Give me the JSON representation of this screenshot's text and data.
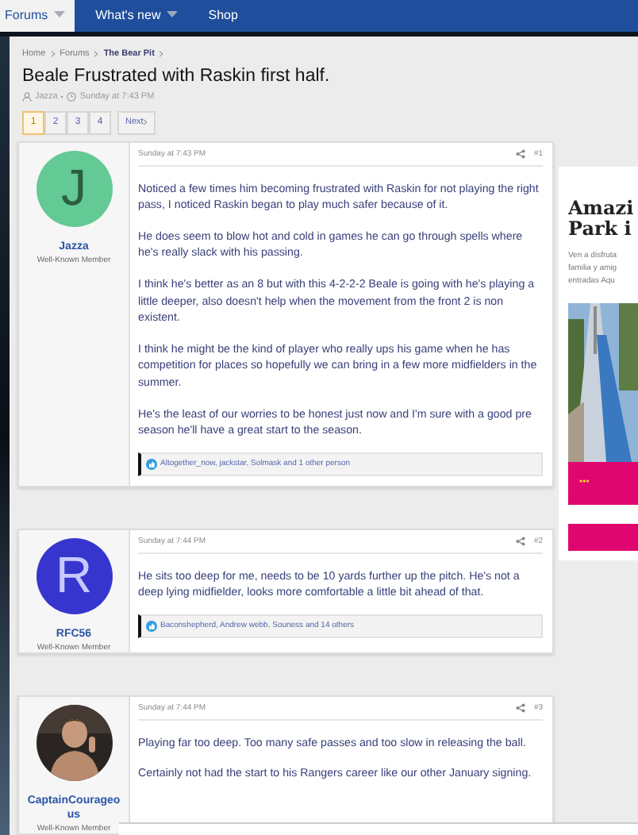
{
  "nav": [
    {
      "label": "Forums",
      "selected": true,
      "dropdown": true
    },
    {
      "label": "What's new",
      "selected": false,
      "dropdown": true
    },
    {
      "label": "Shop",
      "selected": false,
      "dropdown": false
    }
  ],
  "breadcrumb": [
    {
      "label": "Home",
      "bold": false
    },
    {
      "label": "Forums",
      "bold": false
    },
    {
      "label": "The Bear Pit",
      "bold": true
    }
  ],
  "thread": {
    "title": "Beale Frustrated with Raskin first half.",
    "author": "Jazza",
    "date": "Sunday at 7:43 PM"
  },
  "pagination": {
    "pages": [
      {
        "label": "1",
        "selected": true
      },
      {
        "label": "2",
        "selected": false
      },
      {
        "label": "3",
        "selected": false
      },
      {
        "label": "4",
        "selected": false
      }
    ],
    "next": "Next"
  },
  "posts": [
    {
      "avatar": {
        "kind": "letter",
        "letter": "J",
        "color": "#63c995"
      },
      "username": "Jazza",
      "role": "Well-Known Member",
      "date": "Sunday at 7:43 PM",
      "number": "#1",
      "paragraphs": [
        "Noticed a few times him becoming frustrated with Raskin for not playing the right pass, I noticed Raskin began to play much safer because of it.",
        "He does seem to blow hot and cold in games he can go through spells where he's really slack with his passing.",
        "I think he's better as an 8 but with this 4-2-2-2 Beale is going with he's playing a little deeper, also doesn't help when the movement from the front 2 is non existent.",
        "I think he might be the kind of player who really ups his game when he has competition for places so hopefully we can bring in a few more midfielders in the summer.",
        "He's the least of our worries to be honest just now and I'm sure with a good pre season he'll have a great start to the season."
      ],
      "reactions": "Altogether_now, jackstar, Solmask and 1 other person"
    },
    {
      "avatar": {
        "kind": "letter",
        "letter": "R",
        "color": "#3636cf"
      },
      "username": "RFC56",
      "role": "Well-Known Member",
      "date": "Sunday at 7:44 PM",
      "number": "#2",
      "paragraphs": [
        "He sits too deep for me, needs to be 10 yards further up the pitch. He's not a deep lying midfielder, looks more comfortable a little bit ahead of that."
      ],
      "reactions": "Baconshepherd, Andrew webb, Souness and 14 others"
    },
    {
      "avatar": {
        "kind": "picture"
      },
      "username": "CaptainCourageous",
      "role": "Well-Known Member",
      "date": "Sunday at 7:44 PM",
      "number": "#3",
      "paragraphs": [
        "Playing far too deep. Too many safe passes and too slow in releasing the ball.",
        "Certainly not had the start to his Rangers career like our other January signing."
      ]
    }
  ],
  "ad": {
    "heading_lines": [
      "Amazi",
      "Park i"
    ],
    "text_lines": [
      "Ven a disfruta",
      "familia y amig",
      "entradas Aqu"
    ],
    "dots": "•••"
  }
}
